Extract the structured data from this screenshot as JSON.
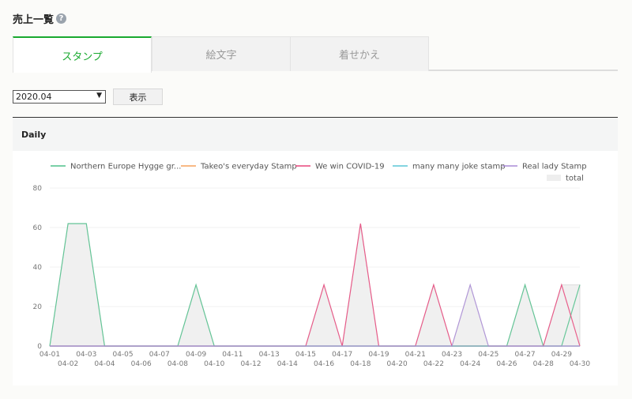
{
  "page": {
    "title": "売上一覧",
    "help_icon": "?"
  },
  "tabs": [
    {
      "label": "スタンプ",
      "active": true
    },
    {
      "label": "絵文字",
      "active": false
    },
    {
      "label": "着せかえ",
      "active": false
    }
  ],
  "controls": {
    "selected_month": "2020.04",
    "caret": "▼",
    "show_button": "表示"
  },
  "panel": {
    "title": "Daily"
  },
  "colors": {
    "accent": "#19a92f"
  },
  "chart_data": {
    "type": "area",
    "x": [
      "04-01",
      "04-02",
      "04-03",
      "04-04",
      "04-05",
      "04-06",
      "04-07",
      "04-08",
      "04-09",
      "04-10",
      "04-11",
      "04-12",
      "04-13",
      "04-14",
      "04-15",
      "04-16",
      "04-17",
      "04-18",
      "04-19",
      "04-20",
      "04-21",
      "04-22",
      "04-23",
      "04-24",
      "04-25",
      "04-26",
      "04-27",
      "04-28",
      "04-29",
      "04-30"
    ],
    "ylim": [
      0,
      80
    ],
    "yticks": [
      0,
      20,
      40,
      60,
      80
    ],
    "grid": true,
    "legend_position": "top",
    "series": [
      {
        "name": "Northern Europe Hygge gr...",
        "color": "#4fc08a",
        "values": [
          0,
          62,
          62,
          0,
          0,
          0,
          0,
          0,
          31,
          0,
          0,
          0,
          0,
          0,
          0,
          0,
          0,
          0,
          0,
          0,
          0,
          0,
          0,
          0,
          0,
          0,
          31,
          0,
          0,
          31
        ]
      },
      {
        "name": "Takeo's everyday Stamp",
        "color": "#f5a25d",
        "values": [
          0,
          0,
          0,
          0,
          0,
          0,
          0,
          0,
          0,
          0,
          0,
          0,
          0,
          0,
          0,
          0,
          0,
          0,
          0,
          0,
          0,
          0,
          0,
          0,
          0,
          0,
          0,
          0,
          0,
          0
        ]
      },
      {
        "name": "We win COVID-19",
        "color": "#e8457a",
        "values": [
          0,
          0,
          0,
          0,
          0,
          0,
          0,
          0,
          0,
          0,
          0,
          0,
          0,
          0,
          0,
          31,
          0,
          62,
          0,
          0,
          0,
          31,
          0,
          0,
          0,
          0,
          0,
          0,
          31,
          0
        ]
      },
      {
        "name": "many many joke stamp",
        "color": "#5bc6d6",
        "values": [
          0,
          0,
          0,
          0,
          0,
          0,
          0,
          0,
          0,
          0,
          0,
          0,
          0,
          0,
          0,
          0,
          0,
          0,
          0,
          0,
          0,
          0,
          0,
          0,
          0,
          0,
          0,
          0,
          0,
          0
        ]
      },
      {
        "name": "Real lady Stamp",
        "color": "#a98bd6",
        "values": [
          0,
          0,
          0,
          0,
          0,
          0,
          0,
          0,
          0,
          0,
          0,
          0,
          0,
          0,
          0,
          0,
          0,
          0,
          0,
          0,
          0,
          0,
          0,
          31,
          0,
          0,
          0,
          0,
          0,
          0
        ]
      },
      {
        "name": "total",
        "color": "#eeeeee",
        "values": [
          0,
          62,
          62,
          0,
          0,
          0,
          0,
          0,
          31,
          0,
          0,
          0,
          0,
          0,
          0,
          31,
          0,
          62,
          0,
          0,
          0,
          31,
          0,
          31,
          0,
          0,
          31,
          0,
          31,
          31
        ]
      }
    ]
  }
}
